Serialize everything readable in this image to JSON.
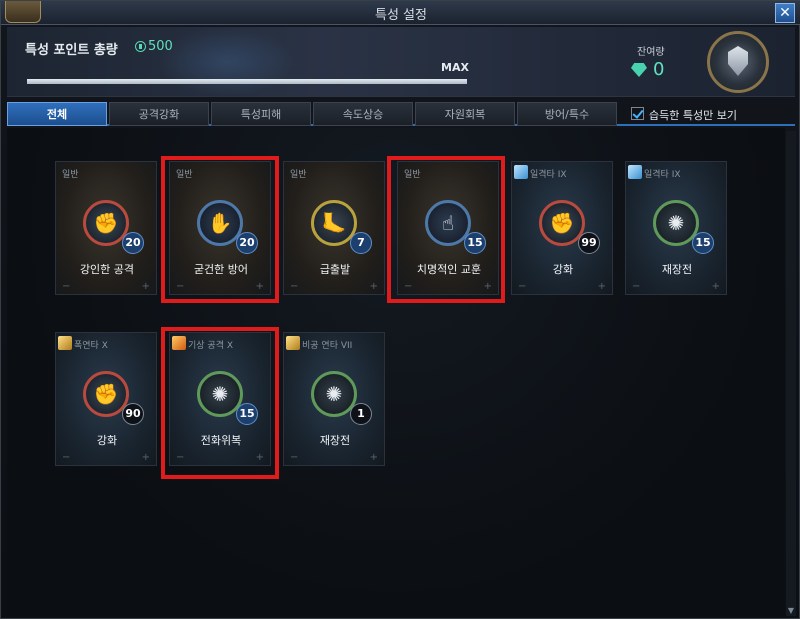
{
  "window": {
    "title": "특성 설정",
    "close_label": "✕"
  },
  "header": {
    "points_label": "특성 포인트 총량",
    "points_value": "500",
    "max_label": "MAX",
    "progress": 1.0,
    "remaining_label": "잔여량",
    "remaining_value": "0"
  },
  "tabs": [
    {
      "label": "전체",
      "active": true
    },
    {
      "label": "공격강화",
      "active": false
    },
    {
      "label": "특성피해",
      "active": false
    },
    {
      "label": "속도상승",
      "active": false
    },
    {
      "label": "자원회복",
      "active": false
    },
    {
      "label": "방어/특수",
      "active": false
    }
  ],
  "filter": {
    "label": "습득한 특성만 보기",
    "checked": true
  },
  "cards": [
    {
      "type": "일반",
      "name": "강인한 공격",
      "level": "20",
      "ring": "red",
      "glyph": "✊"
    },
    {
      "type": "일반",
      "name": "굳건한 방어",
      "level": "20",
      "ring": "blue",
      "glyph": "✋"
    },
    {
      "type": "일반",
      "name": "급출발",
      "level": "7",
      "ring": "yellow",
      "glyph": "🦶"
    },
    {
      "type": "일반",
      "name": "치명적인 교훈",
      "level": "15",
      "ring": "blue",
      "glyph": "☝"
    },
    {
      "type": "일격타 IX",
      "name": "강화",
      "level": "99",
      "ring": "red",
      "glyph": "✊"
    },
    {
      "type": "일격타 IX",
      "name": "재장전",
      "level": "15",
      "ring": "green",
      "glyph": "✺"
    },
    {
      "type": "폭연타 X",
      "name": "강화",
      "level": "90",
      "ring": "red",
      "glyph": "✊"
    },
    {
      "type": "기상 공격 X",
      "name": "전화위복",
      "level": "15",
      "ring": "green",
      "glyph": "✺"
    },
    {
      "type": "비공 연타 VII",
      "name": "재장전",
      "level": "1",
      "ring": "green",
      "glyph": "✺"
    }
  ],
  "card_controls": {
    "minus": "−",
    "plus": "+"
  },
  "colors": {
    "highlight": "#e01b1b",
    "accent": "#2f6fbc",
    "points": "#61e0bd"
  }
}
